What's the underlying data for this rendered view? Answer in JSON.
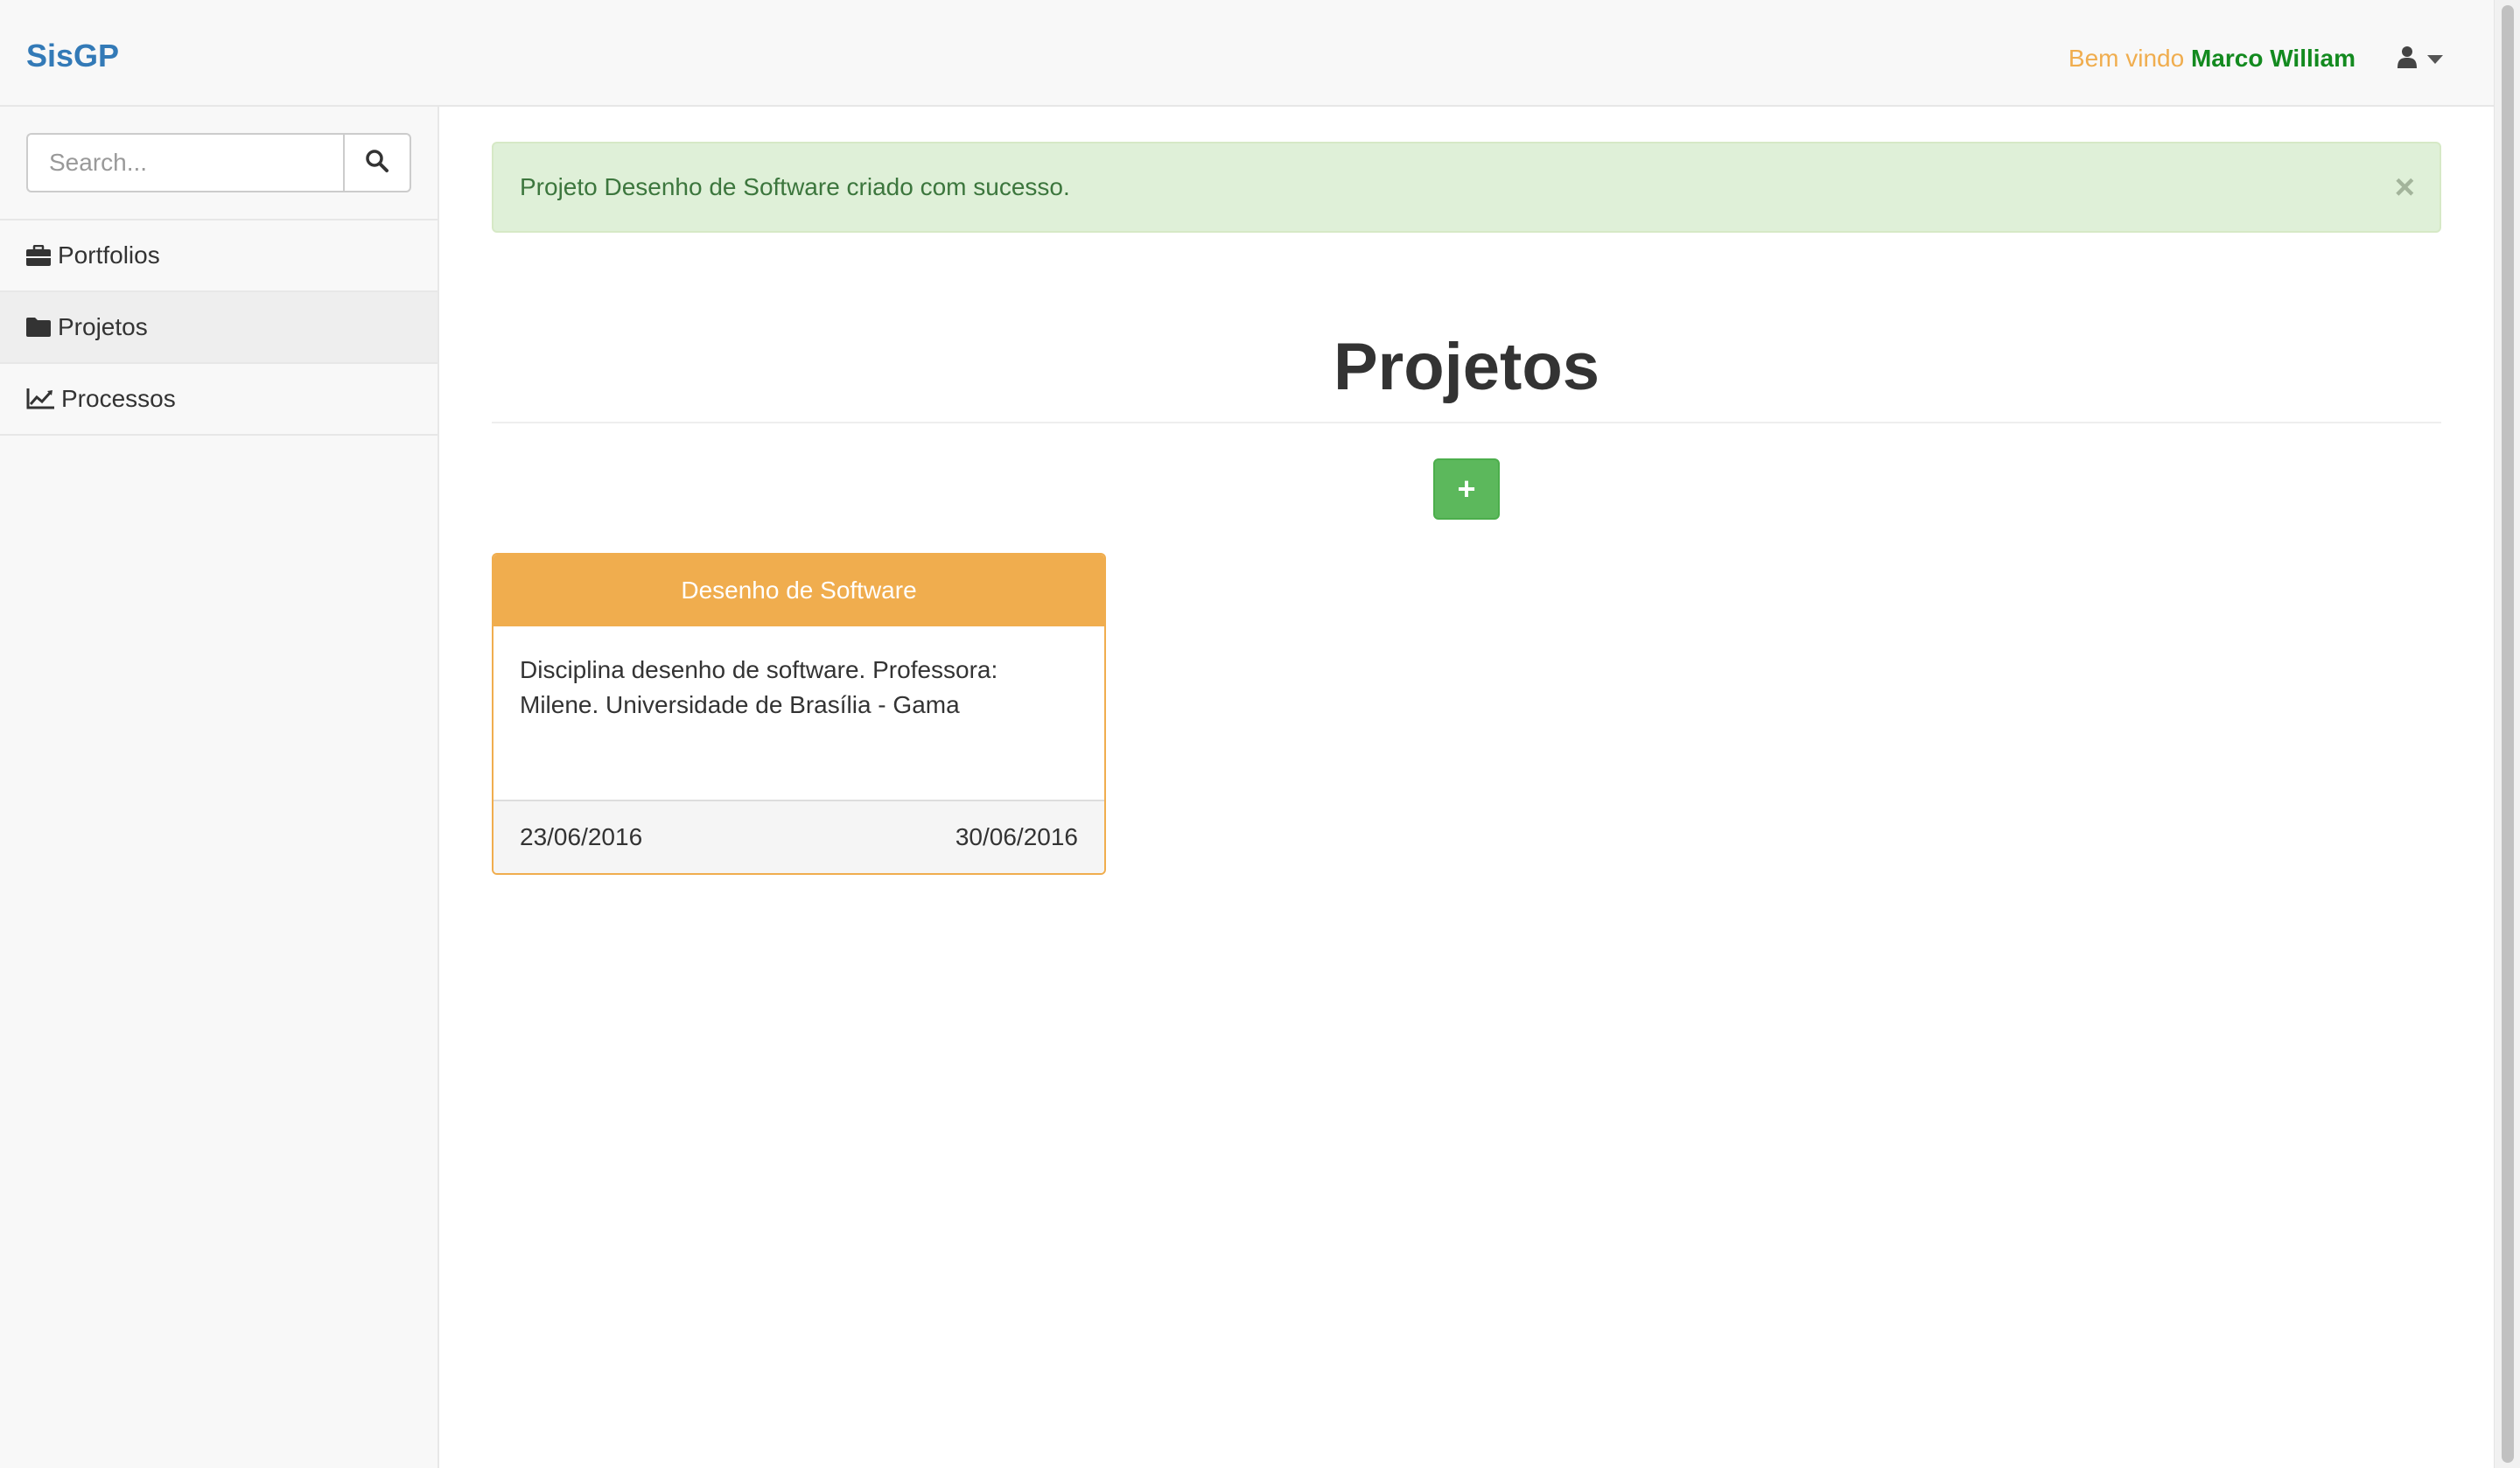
{
  "navbar": {
    "brand": "SisGP",
    "welcome_prefix": "Bem vindo",
    "user_name": "Marco William",
    "user_icon": "user-icon"
  },
  "sidebar": {
    "search": {
      "placeholder": "Search...",
      "value": "",
      "icon": "search-icon"
    },
    "items": [
      {
        "label": "Portfolios",
        "icon": "briefcase-icon",
        "active": false
      },
      {
        "label": "Projetos",
        "icon": "folder-icon",
        "active": true
      },
      {
        "label": "Processos",
        "icon": "line-chart-icon",
        "active": false
      }
    ]
  },
  "alert": {
    "message": "Projeto Desenho de Software criado com sucesso.",
    "close_label": "×"
  },
  "page": {
    "title": "Projetos",
    "add_button_label": "+"
  },
  "projects": [
    {
      "name": "Desenho de Software",
      "description": "Disciplina desenho de software. Professora: Milene. Universidade de Brasília - Gama",
      "start_date": "23/06/2016",
      "end_date": "30/06/2016"
    }
  ],
  "colors": {
    "brand": "#337ab7",
    "warning": "#f0ad4e",
    "success": "#5cb85c",
    "alert_bg": "#dff0d8",
    "alert_text": "#3c763d",
    "user_name": "#138a1f"
  }
}
